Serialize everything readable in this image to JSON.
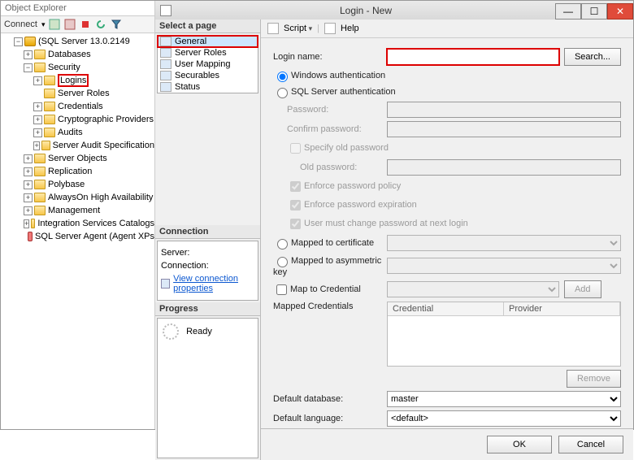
{
  "oe": {
    "title": "Object Explorer",
    "connect_label": "Connect",
    "server_label": "(SQL Server 13.0.2149",
    "nodes": {
      "databases": "Databases",
      "security": "Security",
      "logins": "Logins",
      "server_roles": "Server Roles",
      "credentials": "Credentials",
      "crypto": "Cryptographic Providers",
      "audits": "Audits",
      "audit_spec": "Server Audit Specification",
      "server_objects": "Server Objects",
      "replication": "Replication",
      "polybase": "Polybase",
      "alwayson": "AlwaysOn High Availability",
      "management": "Management",
      "isc": "Integration Services Catalogs",
      "agent": "SQL Server Agent (Agent XPs"
    }
  },
  "dlg": {
    "title": "Login - New",
    "pages_header": "Select a page",
    "pages": {
      "general": "General",
      "server_roles": "Server Roles",
      "user_mapping": "User Mapping",
      "securables": "Securables",
      "status": "Status"
    },
    "toolbar": {
      "script": "Script",
      "help": "Help"
    },
    "form": {
      "login_name": "Login name:",
      "search": "Search...",
      "win_auth": "Windows authentication",
      "sql_auth": "SQL Server authentication",
      "password": "Password:",
      "confirm": "Confirm password:",
      "specify_old": "Specify old password",
      "old_pw": "Old password:",
      "enforce_policy": "Enforce password policy",
      "enforce_exp": "Enforce password expiration",
      "must_change": "User must change password at next login",
      "map_cert": "Mapped to certificate",
      "map_akey": "Mapped to asymmetric key",
      "map_cred": "Map to Credential",
      "add": "Add",
      "mapped_creds": "Mapped Credentials",
      "col_cred": "Credential",
      "col_prov": "Provider",
      "remove": "Remove",
      "def_db": "Default database:",
      "def_db_val": "master",
      "def_lang": "Default language:",
      "def_lang_val": "<default>"
    },
    "conn": {
      "header": "Connection",
      "server": "Server:",
      "connection": "Connection:",
      "link": "View connection properties"
    },
    "prog": {
      "header": "Progress",
      "ready": "Ready"
    },
    "buttons": {
      "ok": "OK",
      "cancel": "Cancel"
    }
  }
}
